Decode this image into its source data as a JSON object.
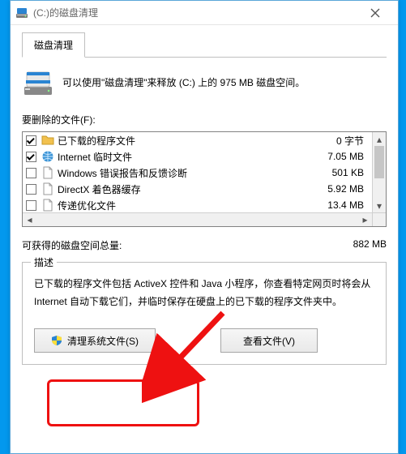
{
  "window": {
    "title": "(C:)的磁盘清理",
    "close_tooltip": "关闭"
  },
  "tabs": {
    "active": "磁盘清理"
  },
  "info": {
    "text": "可以使用\"磁盘清理\"来释放  (C:) 上的 975 MB 磁盘空间。"
  },
  "filelist": {
    "label": "要删除的文件(F):",
    "items": [
      {
        "checked": true,
        "icon": "folder",
        "name": "已下载的程序文件",
        "size": "0 字节"
      },
      {
        "checked": true,
        "icon": "globe",
        "name": "Internet 临时文件",
        "size": "7.05 MB"
      },
      {
        "checked": false,
        "icon": "file",
        "name": "Windows 错误报告和反馈诊断",
        "size": "501 KB"
      },
      {
        "checked": false,
        "icon": "file",
        "name": "DirectX 着色器缓存",
        "size": "5.92 MB"
      },
      {
        "checked": false,
        "icon": "file",
        "name": "传递优化文件",
        "size": "13.4 MB"
      }
    ]
  },
  "total": {
    "label": "可获得的磁盘空间总量:",
    "value": "882 MB"
  },
  "description": {
    "legend": "描述",
    "text": "已下载的程序文件包括 ActiveX 控件和 Java 小程序，你查看特定网页时将会从 Internet 自动下载它们，并临时保存在硬盘上的已下载的程序文件夹中。"
  },
  "buttons": {
    "clean_system": "清理系统文件(S)",
    "view_files": "查看文件(V)"
  }
}
